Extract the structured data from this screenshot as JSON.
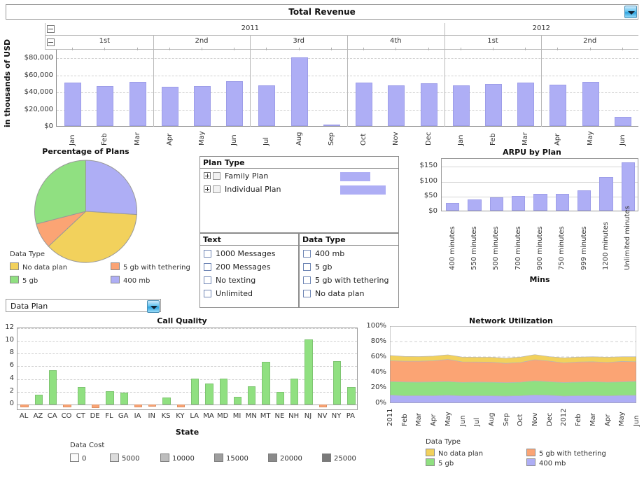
{
  "header": {
    "title": "Total Revenue",
    "dropdown_icon": "chevron-down-icon"
  },
  "revenue": {
    "ylabel": "in thousands of USD",
    "years": [
      "2011",
      "2012"
    ],
    "quarters": [
      "1st",
      "2nd",
      "3rd",
      "4th",
      "1st",
      "2nd"
    ],
    "collapse_icon": "collapse-minus-icon"
  },
  "filters": {
    "plan_type": {
      "header": "Plan Type",
      "rows": [
        {
          "label": "Family Plan",
          "bar": 43
        },
        {
          "label": "Individual Plan",
          "bar": 65
        }
      ]
    },
    "text": {
      "header": "Text",
      "options": [
        "1000 Messages",
        "200 Messages",
        "No texting",
        "Unlimited"
      ]
    },
    "data_type": {
      "header": "Data Type",
      "options": [
        "400 mb",
        "5 gb",
        "5 gb with tethering",
        "No data plan"
      ]
    },
    "data_plan_select": {
      "value": "Data Plan",
      "dropdown_icon": "chevron-down-icon"
    }
  },
  "legends": {
    "pie_legend": {
      "title": "Data Type",
      "items": [
        {
          "label": "No data plan",
          "color": "#f2d15c"
        },
        {
          "label": "5 gb with tethering",
          "color": "#fba474"
        },
        {
          "label": "5 gb",
          "color": "#90e081"
        },
        {
          "label": "400 mb",
          "color": "#aeaef5"
        }
      ]
    },
    "area_legend": {
      "title": "Data Type",
      "items": [
        {
          "label": "No data plan",
          "color": "#f2d15c"
        },
        {
          "label": "5 gb with tethering",
          "color": "#fba474"
        },
        {
          "label": "5 gb",
          "color": "#90e081"
        },
        {
          "label": "400 mb",
          "color": "#aeaef5"
        }
      ]
    },
    "data_cost": {
      "title": "Data Cost",
      "items": [
        {
          "label": "0",
          "color": "#fbfbfb"
        },
        {
          "label": "5000",
          "color": "#dcdcdc"
        },
        {
          "label": "10000",
          "color": "#bdbdbd"
        },
        {
          "label": "15000",
          "color": "#9e9e9e"
        },
        {
          "label": "20000",
          "color": "#8a8a8a"
        },
        {
          "label": "25000",
          "color": "#7a7a7a"
        }
      ]
    }
  },
  "chart_data": [
    {
      "id": "total_revenue",
      "type": "bar",
      "title": "Total Revenue",
      "xlabel": "",
      "ylabel": "in thousands of USD",
      "ylim": [
        0,
        90000
      ],
      "yticks": [
        "$0",
        "$20,000",
        "$40,000",
        "$60,000",
        "$80,000"
      ],
      "ytick_values": [
        0,
        20000,
        40000,
        60000,
        80000
      ],
      "grid": true,
      "color": "#aeaef5",
      "categories": [
        "Jan",
        "Feb",
        "Mar",
        "Apr",
        "May",
        "Jun",
        "Jul",
        "Aug",
        "Sep",
        "Oct",
        "Nov",
        "Dec",
        "Jan",
        "Feb",
        "Mar",
        "Apr",
        "May",
        "Jun"
      ],
      "groups": [
        {
          "year": "2011",
          "quarters": [
            "1st",
            "2nd",
            "3rd",
            "4th"
          ]
        },
        {
          "year": "2012",
          "quarters": [
            "1st",
            "2nd"
          ]
        }
      ],
      "values": [
        50500,
        47000,
        51500,
        46000,
        46800,
        52000,
        47200,
        80500,
        600,
        50500,
        47500,
        50000,
        47200,
        49000,
        51000,
        48500,
        51500,
        11000
      ]
    },
    {
      "id": "percentage_of_plans",
      "type": "pie",
      "title": "Percentage of Plans",
      "legend_title": "Data Type",
      "legend_position": "bottom",
      "slices": [
        {
          "label": "400 mb",
          "value": 26,
          "color": "#aeaef5"
        },
        {
          "label": "No data plan",
          "value": 37,
          "color": "#f2d15c"
        },
        {
          "label": "5 gb with tethering",
          "value": 8,
          "color": "#fba474"
        },
        {
          "label": "5 gb",
          "value": 29,
          "color": "#90e081"
        }
      ]
    },
    {
      "id": "arpu_by_plan",
      "type": "bar",
      "title": "ARPU by Plan",
      "xlabel": "Mins",
      "ylabel": "",
      "ylim": [
        0,
        175
      ],
      "yticks": [
        "$0",
        "$50",
        "$100",
        "$150"
      ],
      "ytick_values": [
        0,
        50,
        100,
        150
      ],
      "grid": true,
      "color": "#aeaef5",
      "categories": [
        "400 minutes",
        "550 minutes",
        "500 minutes",
        "700 minutes",
        "900 minutes",
        "750 minutes",
        "999 minutes",
        "1200 minutes",
        "Unlimited minutes"
      ],
      "values": [
        25,
        38,
        44,
        48,
        56,
        56,
        67,
        110,
        158
      ]
    },
    {
      "id": "call_quality",
      "type": "bar",
      "title": "Call Quality",
      "xlabel": "State",
      "ylabel": "",
      "ylim": [
        -1,
        12
      ],
      "yticks": [
        "0",
        "2",
        "4",
        "6",
        "8",
        "10",
        "12"
      ],
      "ytick_values": [
        0,
        2,
        4,
        6,
        8,
        10,
        12
      ],
      "grid": true,
      "positive_color": "#90e081",
      "negative_color": "#fba474",
      "legend_title": "Data Cost",
      "categories": [
        "AL",
        "AZ",
        "CA",
        "CO",
        "CT",
        "DE",
        "FL",
        "GA",
        "IA",
        "IN",
        "KS",
        "KY",
        "LA",
        "MA",
        "MD",
        "MI",
        "MN",
        "MT",
        "NE",
        "NH",
        "NJ",
        "NV",
        "NY",
        "PA"
      ],
      "values": [
        -0.45,
        1.5,
        5.4,
        -0.4,
        2.7,
        -0.6,
        2.1,
        1.9,
        -0.5,
        -0.35,
        1.1,
        -0.4,
        4.05,
        3.3,
        4.05,
        1.2,
        2.9,
        6.7,
        1.95,
        4.05,
        10.2,
        -0.45,
        6.8,
        2.7
      ]
    },
    {
      "id": "network_utilization",
      "type": "area",
      "title": "Network Utilization",
      "xlabel": "",
      "ylabel": "",
      "ylim": [
        0,
        100
      ],
      "yticks": [
        "0%",
        "20%",
        "40%",
        "60%",
        "80%",
        "100%"
      ],
      "ytick_values": [
        0,
        20,
        40,
        60,
        80,
        100
      ],
      "grid": true,
      "stacked": true,
      "legend_title": "Data Type",
      "legend_position": "bottom",
      "x": [
        "2011",
        "Feb",
        "Mar",
        "Apr",
        "May",
        "Jun",
        "Jul",
        "Aug",
        "Sep",
        "Oct",
        "Nov",
        "Dec",
        "2012",
        "Feb",
        "Mar",
        "Apr",
        "May",
        "Jun"
      ],
      "series": [
        {
          "name": "400 mb",
          "color": "#aeaef5",
          "values": [
            10.5,
            9.5,
            9.8,
            9.6,
            10.2,
            9.4,
            9.6,
            9.4,
            9.2,
            9.6,
            10.6,
            10.2,
            9.2,
            9.6,
            9.8,
            9.4,
            10.0,
            10.2
          ]
        },
        {
          "name": "5 gb",
          "color": "#90e081",
          "values": [
            17.5,
            18.0,
            17.5,
            18.0,
            17.8,
            17.6,
            17.8,
            17.8,
            17.5,
            17.6,
            18.4,
            17.6,
            17.6,
            17.8,
            18.0,
            17.8,
            17.6,
            18.2
          ]
        },
        {
          "name": "5 gb with tethering",
          "color": "#fba474",
          "values": [
            27.0,
            27.0,
            27.2,
            27.4,
            28.8,
            26.6,
            26.0,
            26.0,
            25.0,
            25.6,
            27.4,
            26.8,
            25.4,
            26.0,
            26.0,
            25.6,
            26.6,
            25.4
          ]
        },
        {
          "name": "No data plan",
          "color": "#f2d15c",
          "values": [
            6.8,
            6.2,
            6.0,
            6.0,
            6.0,
            6.2,
            6.2,
            6.4,
            6.6,
            7.0,
            6.6,
            5.8,
            6.6,
            6.4,
            6.4,
            6.8,
            6.0,
            6.4
          ]
        }
      ]
    }
  ]
}
